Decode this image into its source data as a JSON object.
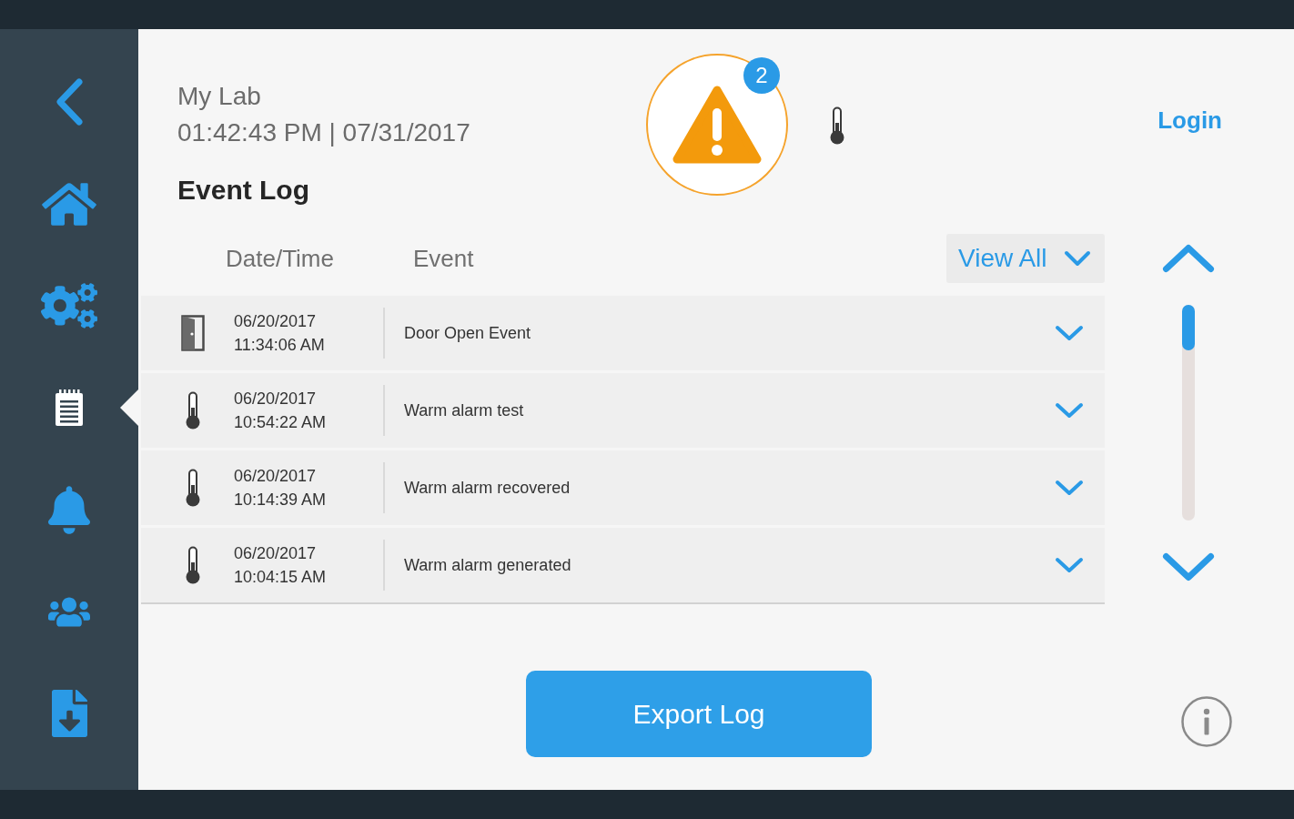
{
  "sidebar": {
    "items": [
      {
        "kind": "back",
        "selected": false
      },
      {
        "kind": "home",
        "selected": false
      },
      {
        "kind": "settings",
        "selected": false
      },
      {
        "kind": "event_log",
        "selected": true
      },
      {
        "kind": "alarms",
        "selected": false
      },
      {
        "kind": "users",
        "selected": false
      },
      {
        "kind": "export",
        "selected": false
      }
    ]
  },
  "header": {
    "location": "My Lab",
    "clock": "01:42:43 PM | 07/31/2017",
    "title": "Event Log",
    "alert_count": "2",
    "login": "Login"
  },
  "table": {
    "columns": [
      "Date/Time",
      "Event"
    ],
    "filter": "View All",
    "rows": [
      {
        "kind": "door",
        "date": "06/20/2017",
        "time": "11:34:06 AM",
        "event": "Door Open Event",
        "expanded": false
      },
      {
        "kind": "temperature",
        "date": "06/20/2017",
        "time": "10:54:22 AM",
        "event": "Warm alarm test",
        "expanded": false
      },
      {
        "kind": "temperature",
        "date": "06/20/2017",
        "time": "10:14:39 AM",
        "event": "Warm alarm recovered",
        "expanded": false
      },
      {
        "kind": "temperature",
        "date": "06/20/2017",
        "time": "10:04:15 AM",
        "event": "Warm alarm generated",
        "expanded": false
      }
    ]
  },
  "export_button": "Export Log"
}
